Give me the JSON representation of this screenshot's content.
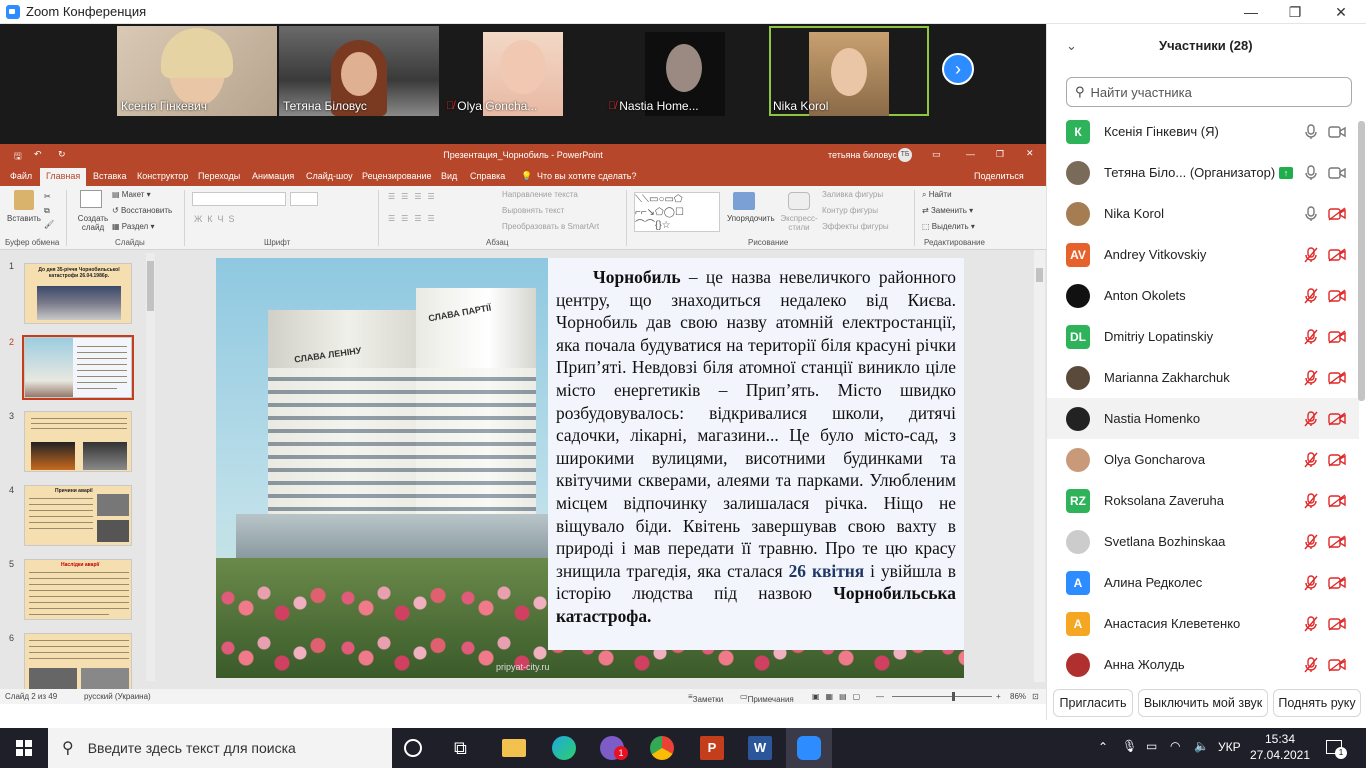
{
  "window": {
    "title": "Zoom Конференция"
  },
  "video_tiles": [
    {
      "name": "Ксенія Гінкевич",
      "muted": false
    },
    {
      "name": "Тетяна Біловус",
      "muted": false
    },
    {
      "name": "Olya Goncha...",
      "muted": true
    },
    {
      "name": "Nastia Home...",
      "muted": true
    },
    {
      "name": "Nika Korol",
      "muted": false
    }
  ],
  "powerpoint": {
    "doc_title": "Презентация_Чорнобиль  -  PowerPoint",
    "user": "тетьяна биловус",
    "user_initials": "ТБ",
    "tabs": [
      "Файл",
      "Главная",
      "Вставка",
      "Конструктор",
      "Переходы",
      "Анимация",
      "Слайд-шоу",
      "Рецензирование",
      "Вид",
      "Справка",
      "Что вы хотите сделать?"
    ],
    "share": "Поделиться",
    "ribbon": {
      "paste": "Вставить",
      "create_slide": "Создать слайд",
      "layout": "Макет",
      "restore": "Восстановить",
      "section": "Раздел",
      "text_direction": "Направление текста",
      "align_text": "Выровнять текст",
      "smartart": "Преобразовать в SmartArt",
      "arrange": "Упорядочить",
      "express_styles": "Экспресс-стили",
      "shape_fill": "Заливка фигуры",
      "shape_outline": "Контур фигуры",
      "shape_effects": "Эффекты фигуры",
      "find": "Найти",
      "replace": "Заменить",
      "select": "Выделить",
      "groups": [
        "Буфер обмена",
        "Слайды",
        "Шрифт",
        "Абзац",
        "Рисование",
        "Редактирование"
      ]
    },
    "thumbs": [
      {
        "num": "1",
        "title": "До дня 35-річчя Чорнобильської катастрофи 26.04.1986р."
      },
      {
        "num": "2"
      },
      {
        "num": "3"
      },
      {
        "num": "4",
        "title": "Причини аварії"
      },
      {
        "num": "5",
        "title": "Наслідки аварії"
      },
      {
        "num": "6"
      }
    ],
    "slide_text": {
      "lead": "Чорнобиль",
      "body": " – це назва невеличкого районного центру, що знаходиться недалеко від Києва. Чорнобиль дав свою назву атомній електростанції, яка почала будуватися на території біля красуні річки Прип’яті. Невдовзі біля атомної станції виникло ціле місто енергетиків – Прип’ять. Місто швидко розбудовувалось: відкривалися школи, дитячі садочки, лікарні, магазини... Це було місто-сад, з широкими вулицями, висотними будинками та квітучими скверами, алеями та парками. Улюбленим місцем відпочинку залишалася річка. Ніщо не віщувало біди. Квітень завершував свою вахту в природі і мав передати її травню. Про те цю красу знищила трагедія, яка сталася ",
      "date": "26 квітня",
      "body2": " і увійшла в історію людства під назвою ",
      "tail": "Чорнобильська катастрофа."
    },
    "building_signs": [
      "СЛАВА ПАРТІЇ",
      "СЛАВА ЛЕНІНУ"
    ],
    "watermark": "pripyat-city.ru",
    "status": {
      "slide": "Слайд 2 из 49",
      "lang": "русский (Украина)",
      "notes": "Заметки",
      "comments": "Примечания",
      "zoom": "86%"
    }
  },
  "participants": {
    "title": "Участники (28)",
    "search_placeholder": "Найти участника",
    "list": [
      {
        "name": "Ксенія Гінкевич (Я)",
        "initials": "К",
        "color": "#2fb35a",
        "mic": "on",
        "cam": "on"
      },
      {
        "name": "Тетяна Біло...  (Организатор)",
        "initials": "",
        "color": "#7a6a5a",
        "mic": "on",
        "cam": "on",
        "sharing": true
      },
      {
        "name": "Nika Korol",
        "initials": "",
        "color": "#a67c52",
        "mic": "on",
        "cam": "off"
      },
      {
        "name": "Andrey Vitkovskiy",
        "initials": "AV",
        "color": "#e5622c",
        "mic": "off",
        "cam": "off"
      },
      {
        "name": "Anton Okolets",
        "initials": "",
        "color": "#111111",
        "mic": "off",
        "cam": "off"
      },
      {
        "name": "Dmitriy Lopatinskiy",
        "initials": "DL",
        "color": "#2fb35a",
        "mic": "off",
        "cam": "off"
      },
      {
        "name": "Marianna Zakharchuk",
        "initials": "",
        "color": "#5a4a3a",
        "mic": "off",
        "cam": "off"
      },
      {
        "name": "Nastia Homenko",
        "initials": "",
        "color": "#222222",
        "mic": "off",
        "cam": "off",
        "highlight": true
      },
      {
        "name": "Olya Goncharova",
        "initials": "",
        "color": "#c89a7a",
        "mic": "off",
        "cam": "off"
      },
      {
        "name": "Roksolana Zaveruha",
        "initials": "RZ",
        "color": "#2fb35a",
        "mic": "off",
        "cam": "off"
      },
      {
        "name": "Svetlana Bozhinskaa",
        "initials": "",
        "color": "#cccccc",
        "mic": "off",
        "cam": "off"
      },
      {
        "name": "Алина Редколес",
        "initials": "А",
        "color": "#2d8cff",
        "mic": "off",
        "cam": "off"
      },
      {
        "name": "Анастасия Клеветенко",
        "initials": "А",
        "color": "#f5a623",
        "mic": "off",
        "cam": "off"
      },
      {
        "name": "Анна Жолудь",
        "initials": "",
        "color": "#b03030",
        "mic": "off",
        "cam": "off"
      }
    ],
    "buttons": [
      "Пригласить",
      "Выключить мой звук",
      "Поднять руку"
    ]
  },
  "taskbar": {
    "search_placeholder": "Введите здесь текст для поиска",
    "lang": "УКР",
    "time": "15:34",
    "date": "27.04.2021",
    "notif_count": "1",
    "viber_badge": "1"
  },
  "colors": {
    "zoom_blue": "#2d8cff",
    "ppt_red": "#b7472a",
    "mute_red": "#e02828"
  }
}
